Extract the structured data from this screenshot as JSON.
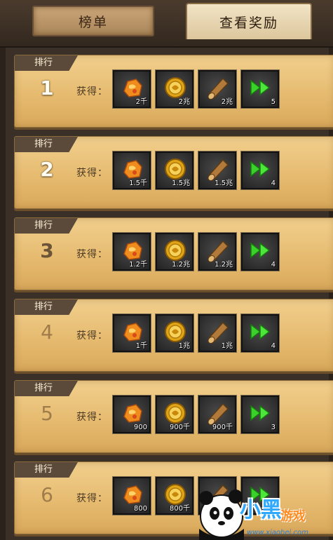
{
  "tabs": {
    "ranking": "榜单",
    "view_rewards": "查看奖励",
    "active": "view_rewards"
  },
  "labels": {
    "rank_tag": "排行",
    "obtain": "获得："
  },
  "icons": [
    "seal-icon",
    "gold-coin-icon",
    "wood-log-icon",
    "green-double-arrow-icon"
  ],
  "rows": [
    {
      "rank": "1",
      "rewards": [
        "2千",
        "2兆",
        "2兆",
        "5"
      ]
    },
    {
      "rank": "2",
      "rewards": [
        "1.5千",
        "1.5兆",
        "1.5兆",
        "4"
      ]
    },
    {
      "rank": "3",
      "rewards": [
        "1.2千",
        "1.2兆",
        "1.2兆",
        "4"
      ]
    },
    {
      "rank": "4",
      "rewards": [
        "1千",
        "1兆",
        "1兆",
        "4"
      ]
    },
    {
      "rank": "5",
      "rewards": [
        "900",
        "900千",
        "900千",
        "3"
      ]
    },
    {
      "rank": "6",
      "rewards": [
        "800",
        "800千",
        "",
        ""
      ]
    }
  ],
  "watermark": {
    "main": "小黑",
    "sub": "游戏",
    "url": "www.xiaohei.com"
  }
}
